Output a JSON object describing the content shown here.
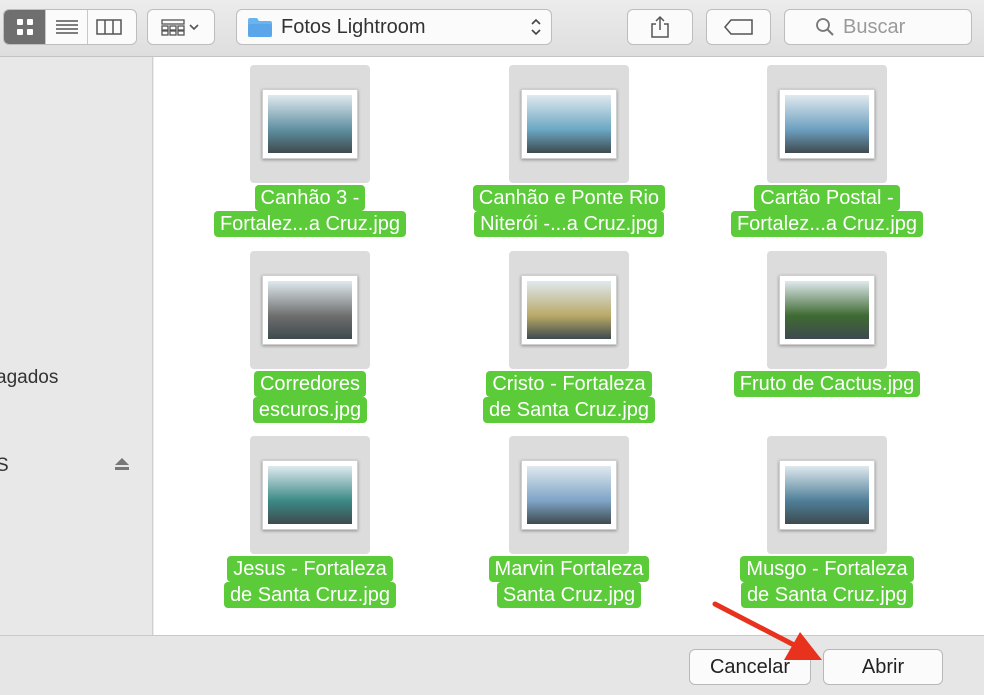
{
  "toolbar": {
    "view_modes": [
      "icon-view",
      "list-view",
      "column-view"
    ],
    "path_popup": {
      "label": "Fotos Lightroom",
      "icon": "folder-icon"
    },
    "search": {
      "placeholder": "Buscar"
    }
  },
  "sidebar": {
    "items": [
      {
        "label": "agados"
      },
      {
        "label": "S"
      }
    ]
  },
  "files": [
    {
      "line1": "Canhão 3 -",
      "line2": "Fortalez...a Cruz.jpg",
      "thumb": "#5f8fa0"
    },
    {
      "line1": "Canhão e Ponte Rio",
      "line2": "Niterói -...a Cruz.jpg",
      "thumb": "#6aa7c3"
    },
    {
      "line1": "Cartão Postal -",
      "line2": "Fortalez...a Cruz.jpg",
      "thumb": "#6c9fbf"
    },
    {
      "line1": "Corredores",
      "line2": "escuros.jpg",
      "thumb": "#6e6e6e"
    },
    {
      "line1": "Cristo - Fortaleza",
      "line2": "de Santa Cruz.jpg",
      "thumb": "#b9a968"
    },
    {
      "line1": "Fruto de Cactus.jpg",
      "line2": "",
      "thumb": "#3f6a32"
    },
    {
      "line1": "Jesus - Fortaleza",
      "line2": "de Santa Cruz.jpg",
      "thumb": "#3b8a86"
    },
    {
      "line1": "Marvin Fortaleza",
      "line2": "Santa Cruz.jpg",
      "thumb": "#7ea4c7"
    },
    {
      "line1": "Musgo - Fortaleza",
      "line2": "de Santa Cruz.jpg",
      "thumb": "#4f7f99"
    }
  ],
  "buttons": {
    "cancel": "Cancelar",
    "open": "Abrir"
  },
  "colors": {
    "selection": "#5ccb3a",
    "arrow": "#e8321e"
  }
}
